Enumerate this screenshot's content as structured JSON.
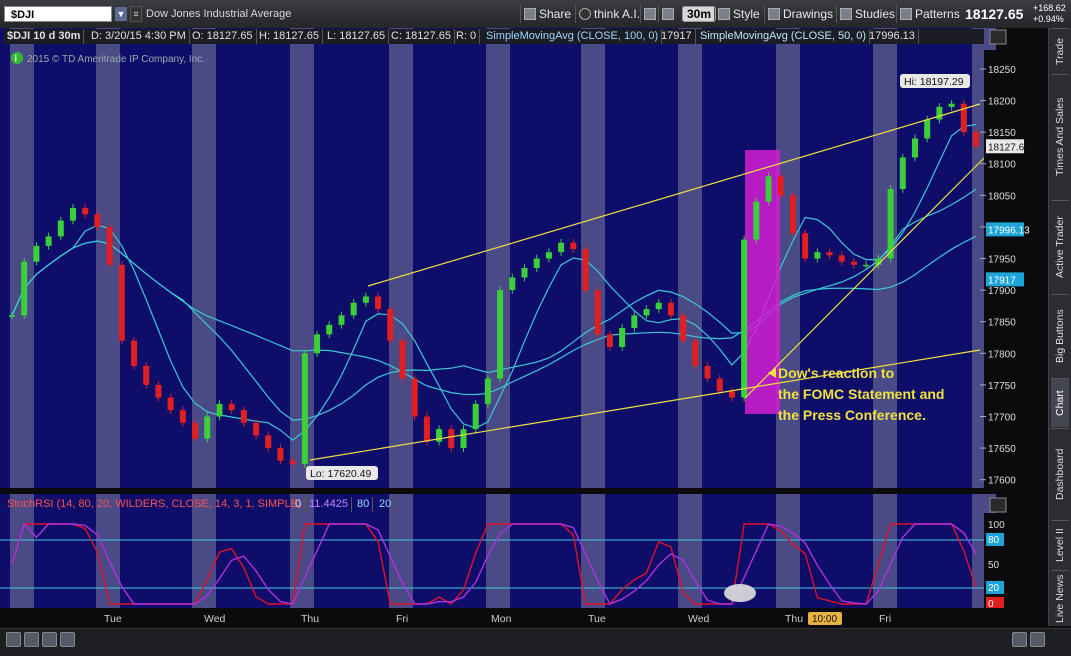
{
  "toolbar": {
    "symbol": "$DJI",
    "symbol_name": "Dow Jones Industrial Average",
    "share": "Share",
    "think_ai": "think A.I.",
    "timeframe": "30m",
    "style": "Style",
    "drawings": "Drawings",
    "studies": "Studies",
    "patterns": "Patterns",
    "last_price": "18127.65",
    "change_abs": "+168.62",
    "change_pct": "+0.94%"
  },
  "infobar": {
    "title": "$DJI 10 d 30m",
    "datetime": "D: 3/20/15 4:30 PM",
    "open": "O: 18127.65",
    "high": "H: 18127.65",
    "low": "L: 18127.65",
    "close": "C: 18127.65",
    "r": "R: 0",
    "ma100_label": "SimpleMovingAvg (CLOSE, 100, 0)",
    "ma100_value": "17917",
    "ma50_label": "SimpleMovingAvg (CLOSE, 50, 0)",
    "ma50_value": "17996.13"
  },
  "copyright": "2015 © TD Ameritrade IP Company, Inc.",
  "price_axis": {
    "ticks": [
      "18250",
      "18200",
      "18150",
      "18100",
      "18050",
      "18000",
      "17950",
      "17900",
      "17850",
      "17800",
      "17750",
      "17700",
      "17650",
      "17600"
    ],
    "last_badge": "18127.65",
    "ma50_badge": "17996.13",
    "ma100_badge": "17917"
  },
  "annotations": {
    "hi_label": "Hi: 18197.29",
    "lo_label": "Lo: 17620.49",
    "note_lines": [
      "Dow's reaction to",
      "the FOMC Statement and",
      "the Press Conference."
    ]
  },
  "stoch": {
    "label": "StochRSI (14, 80, 20, WILDERS, CLOSE, 14, 3, 1, SIMPLE)",
    "value0": "0",
    "k_value": "11.4425",
    "ob": "80",
    "os": "20",
    "axis_ticks": [
      "100",
      "80",
      "50",
      "20",
      "0"
    ],
    "badge_80": "80",
    "badge_20": "20",
    "badge_0": "0"
  },
  "time_axis": {
    "labels": [
      "Tue",
      "Wed",
      "Thu",
      "Fri",
      "Mon",
      "Tue",
      "Wed",
      "Thu",
      "Fri"
    ],
    "time_badge": "10:00"
  },
  "side_tabs": [
    "Trade",
    "Times And Sales",
    "Active Trader",
    "Big Buttons",
    "Chart",
    "Dashboard",
    "Level II",
    "Live News"
  ],
  "colors": {
    "plot_bg": "#0e0e6a",
    "session_band": "#4a4a86",
    "up_candle": "#3bcf3b",
    "down_candle": "#e02020",
    "ma_line": "#3cc7d8",
    "trend_line": "#f0e040",
    "highlight": "#d21fd2",
    "stoch_k": "#e0102a",
    "stoch_d": "#b030e0"
  },
  "chart_data": {
    "type": "candlestick",
    "symbol": "$DJI",
    "interval": "30m",
    "ylim": [
      17590,
      18280
    ],
    "hi": 18197.29,
    "lo": 17620.49,
    "close_path": [
      [
        0,
        17860
      ],
      [
        1,
        17945
      ],
      [
        2,
        17970
      ],
      [
        3,
        17985
      ],
      [
        4,
        18010
      ],
      [
        5,
        18030
      ],
      [
        6,
        18020
      ],
      [
        7,
        18000
      ],
      [
        8,
        17940
      ],
      [
        9,
        17820
      ],
      [
        10,
        17780
      ],
      [
        11,
        17750
      ],
      [
        12,
        17730
      ],
      [
        13,
        17710
      ],
      [
        14,
        17690
      ],
      [
        15,
        17665
      ],
      [
        16,
        17700
      ],
      [
        17,
        17720
      ],
      [
        18,
        17710
      ],
      [
        19,
        17690
      ],
      [
        20,
        17670
      ],
      [
        21,
        17650
      ],
      [
        22,
        17630
      ],
      [
        23,
        17625
      ],
      [
        24,
        17800
      ],
      [
        25,
        17830
      ],
      [
        26,
        17845
      ],
      [
        27,
        17860
      ],
      [
        28,
        17880
      ],
      [
        29,
        17890
      ],
      [
        30,
        17870
      ],
      [
        31,
        17820
      ],
      [
        32,
        17760
      ],
      [
        33,
        17700
      ],
      [
        34,
        17660
      ],
      [
        35,
        17680
      ],
      [
        36,
        17650
      ],
      [
        37,
        17680
      ],
      [
        38,
        17720
      ],
      [
        39,
        17760
      ],
      [
        40,
        17900
      ],
      [
        41,
        17920
      ],
      [
        42,
        17935
      ],
      [
        43,
        17950
      ],
      [
        44,
        17960
      ],
      [
        45,
        17975
      ],
      [
        46,
        17965
      ],
      [
        47,
        17900
      ],
      [
        48,
        17830
      ],
      [
        49,
        17810
      ],
      [
        50,
        17840
      ],
      [
        51,
        17860
      ],
      [
        52,
        17870
      ],
      [
        53,
        17880
      ],
      [
        54,
        17860
      ],
      [
        55,
        17820
      ],
      [
        56,
        17780
      ],
      [
        57,
        17760
      ],
      [
        58,
        17740
      ],
      [
        59,
        17730
      ],
      [
        60,
        17980
      ],
      [
        61,
        18040
      ],
      [
        62,
        18080
      ],
      [
        63,
        18050
      ],
      [
        64,
        17990
      ],
      [
        65,
        17950
      ],
      [
        66,
        17960
      ],
      [
        67,
        17955
      ],
      [
        68,
        17945
      ],
      [
        69,
        17940
      ],
      [
        70,
        17940
      ],
      [
        71,
        17950
      ],
      [
        72,
        18060
      ],
      [
        73,
        18110
      ],
      [
        74,
        18140
      ],
      [
        75,
        18170
      ],
      [
        76,
        18190
      ],
      [
        77,
        18195
      ],
      [
        78,
        18150
      ],
      [
        79,
        18127.65
      ]
    ]
  }
}
